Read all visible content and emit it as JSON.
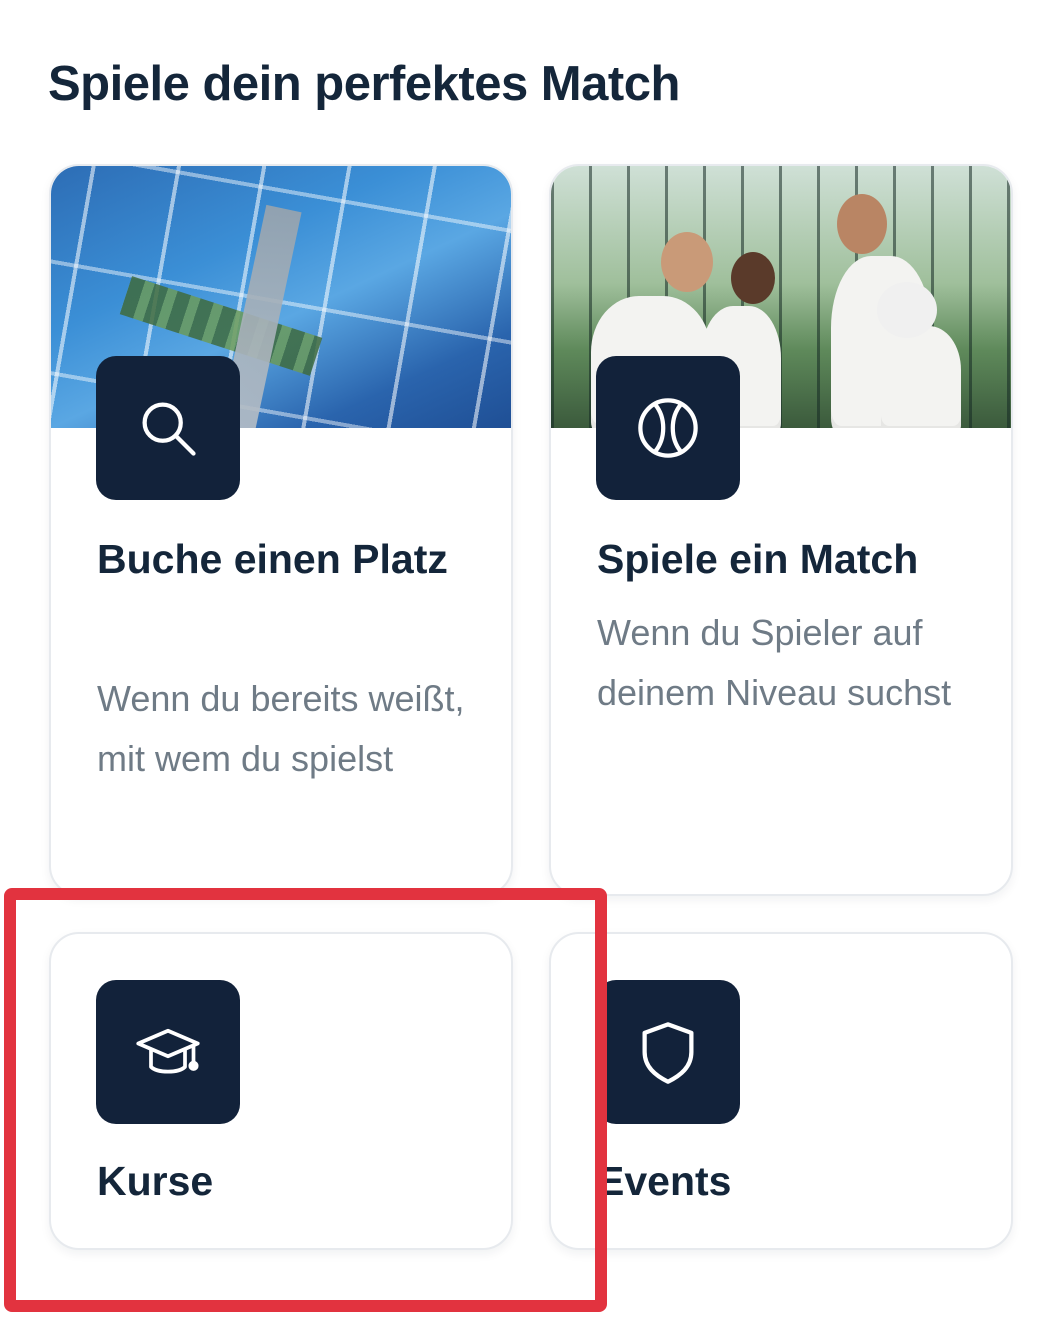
{
  "section": {
    "title": "Spiele dein perfektes Match"
  },
  "cards": [
    {
      "title": "Buche einen Platz",
      "description": "Wenn du bereits weißt, mit wem du spielst",
      "icon": "search-icon",
      "image": "aerial-courts-photo"
    },
    {
      "title": "Spiele ein Match",
      "description": "Wenn du Spieler auf deinem Niveau suchst",
      "icon": "tennis-ball-icon",
      "image": "players-photo"
    },
    {
      "title": "Kurse",
      "icon": "graduation-cap-icon"
    },
    {
      "title": "Events",
      "icon": "shield-icon"
    }
  ],
  "highlight": {
    "target": "Kurse",
    "color": "#e2333f"
  },
  "colors": {
    "icon_tile": "#12223a",
    "title": "#14263a",
    "description": "#6f7b86",
    "card_border": "#e7eaee"
  }
}
